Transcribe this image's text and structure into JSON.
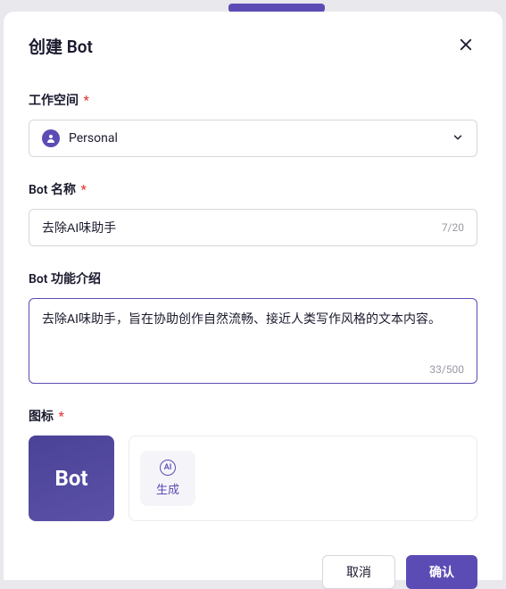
{
  "modal": {
    "title": "创建 Bot"
  },
  "workspace": {
    "label": "工作空间",
    "selected": "Personal"
  },
  "botName": {
    "label": "Bot 名称",
    "value": "去除AI味助手",
    "count": "7/20"
  },
  "botDesc": {
    "label": "Bot 功能介绍",
    "value": "去除AI味助手，旨在协助创作自然流畅、接近人类写作风格的文本内容。",
    "count": "33/500"
  },
  "icon": {
    "label": "图标",
    "previewText": "Bot",
    "aiLabel": "AI",
    "genLabel": "生成"
  },
  "footer": {
    "cancel": "取消",
    "confirm": "确认"
  }
}
